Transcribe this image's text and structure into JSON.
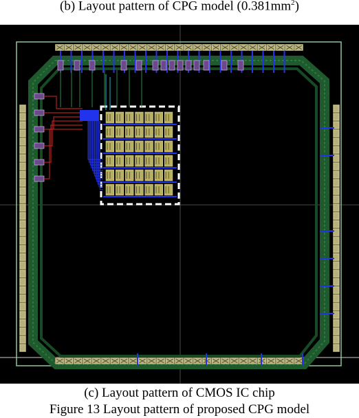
{
  "figure": {
    "caption_b_prefix": "(b) Layout pattern of CPG model (0.381mm",
    "caption_b_superscript": "2",
    "caption_b_suffix": ")",
    "caption_c": "(c) Layout pattern of CMOS IC chip",
    "title": "Figure 13 Layout pattern of proposed CPG model"
  },
  "colors": {
    "background": "#000000",
    "ring_green": "#1f5a2e",
    "pad_tan": "#b8b07a",
    "routing_blue": "#2233ee",
    "routing_red": "#b02020",
    "core_yellow": "#b8b060",
    "highlight_box": "#ffffff"
  },
  "layout": {
    "top_pad_count": 27,
    "bottom_pad_count": 27,
    "left_pad_count": 30,
    "right_pad_count": 30,
    "core_grid_columns": 7,
    "core_grid_rows": 6
  }
}
